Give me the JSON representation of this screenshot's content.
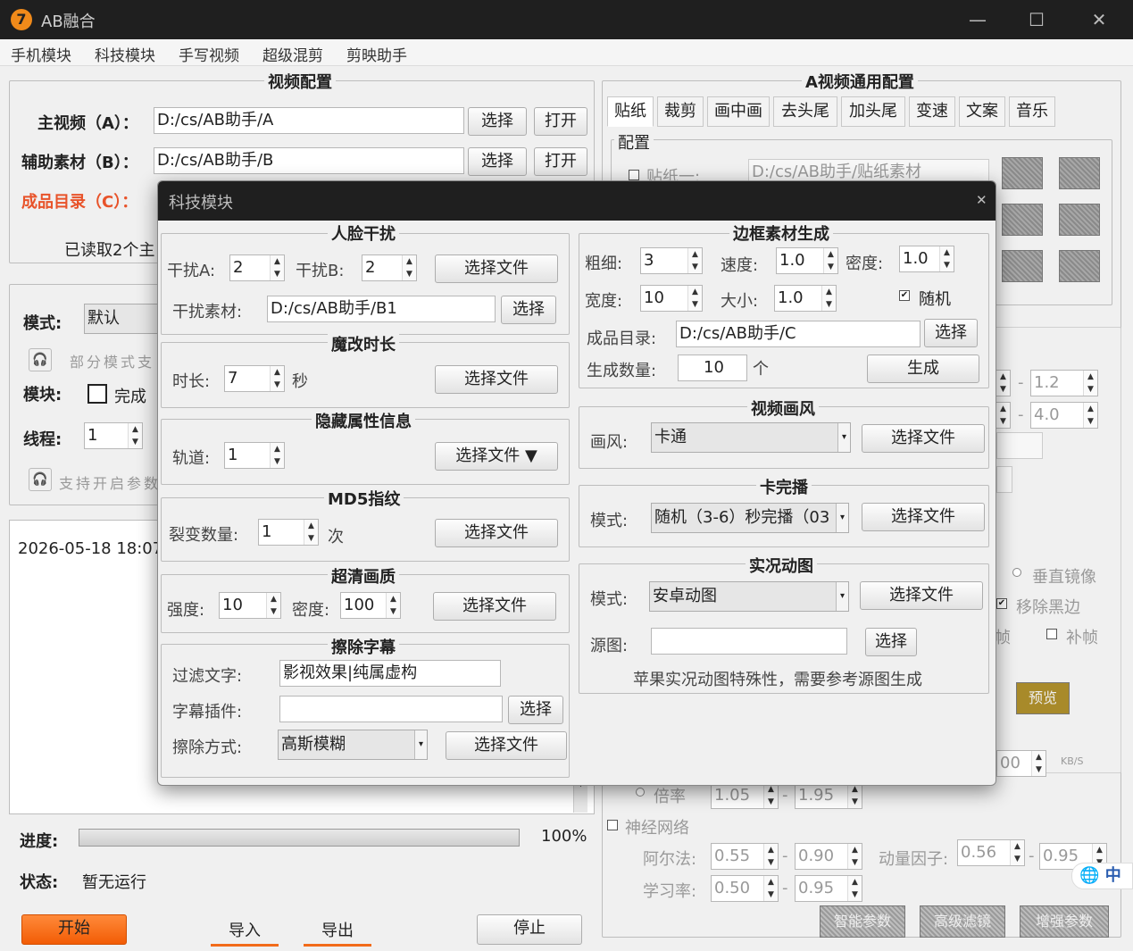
{
  "window": {
    "title": "AB融合",
    "icon_char": "7",
    "minimize": "—",
    "maximize": "☐",
    "close": "✕"
  },
  "menu": [
    "手机模块",
    "科技模块",
    "手写视频",
    "超级混剪",
    "剪映助手"
  ],
  "video_config": {
    "title": "视频配置",
    "main_label": "主视频（A）：",
    "main_path": "D:/cs/AB助手/A",
    "aux_label": "辅助素材（B）：",
    "aux_path": "D:/cs/AB助手/B",
    "output_label": "成品目录（C）：",
    "read_status": "已读取2个主",
    "select": "选择",
    "open": "打开"
  },
  "mode_section": {
    "mode_label": "模式:",
    "mode_value": "默认",
    "tip1": "部分模式支",
    "module_label": "模块:",
    "module_check_text": "完成",
    "thread_label": "线程:",
    "thread_value": "1",
    "tip2": "支持开启参数"
  },
  "log": {
    "line1": "2026-05-18 18:07"
  },
  "progress": {
    "label": "进度:",
    "value": 100,
    "text": "100%"
  },
  "status": {
    "label": "状态:",
    "value": "暂无运行"
  },
  "bottom_buttons": {
    "start": "开始",
    "import": "导入",
    "export": "导出",
    "stop": "停止"
  },
  "right_panel": {
    "title": "A视频通用配置",
    "tabs": [
      "贴纸",
      "裁剪",
      "画中画",
      "去头尾",
      "加头尾",
      "变速",
      "文案",
      "音乐"
    ],
    "config_title": "配置",
    "sticker_label": "贴纸一:",
    "sticker_path": "D:/cs/AB助手/贴纸素材",
    "range1_sep": "-",
    "range1_hi": "1.2",
    "range2_sep": "-",
    "range2_hi": "4.0",
    "vertical_mirror": "垂直镜像",
    "remove_black": "移除黑边",
    "frame_fill": "补帧",
    "frame_partial": "帧",
    "preview": "预览",
    "bitrate_partial": "00",
    "bitrate_unit": "KB/S",
    "ratio_label": "倍率",
    "ratio_lo": "1.05",
    "ratio_sep": "-",
    "ratio_hi": "1.95",
    "neural_label": "神经网络",
    "alpha_label": "阿尔法:",
    "alpha_lo": "0.55",
    "alpha_sep": "-",
    "alpha_hi": "0.90",
    "momentum_label": "动量因子:",
    "momentum_lo": "0.56",
    "momentum_sep": "-",
    "momentum_hi": "0.95",
    "lr_label": "学习率:",
    "lr_lo": "0.50",
    "lr_sep": "-",
    "lr_hi": "0.95",
    "ime_text": "中",
    "bottom_btns": [
      "智能参数",
      "高级滤镜",
      "增强参数"
    ]
  },
  "modal": {
    "title": "科技模块",
    "close": "✕",
    "face": {
      "title": "人脸干扰",
      "a_label": "干扰A:",
      "a_value": "2",
      "b_label": "干扰B:",
      "b_value": "2",
      "select_file": "选择文件",
      "material_label": "干扰素材:",
      "material_path": "D:/cs/AB助手/B1",
      "select": "选择"
    },
    "duration": {
      "title": "魔改时长",
      "label": "时长:",
      "value": "7",
      "unit": "秒",
      "select_file": "选择文件"
    },
    "hidden": {
      "title": "隐藏属性信息",
      "label": "轨道:",
      "value": "1",
      "select_file": "选择文件",
      "arrow": "▼"
    },
    "md5": {
      "title": "MD5指纹",
      "label": "裂变数量:",
      "value": "1",
      "unit": "次",
      "select_file": "选择文件"
    },
    "hd": {
      "title": "超清画质",
      "strength_label": "强度:",
      "strength_value": "10",
      "density_label": "密度:",
      "density_value": "100",
      "select_file": "选择文件"
    },
    "subtitle": {
      "title": "擦除字幕",
      "filter_label": "过滤文字:",
      "filter_value": "影视效果|纯属虚构",
      "plugin_label": "字幕插件:",
      "plugin_value": "",
      "select": "选择",
      "method_label": "擦除方式:",
      "method_value": "高斯模糊",
      "select_file": "选择文件"
    },
    "border": {
      "title": "边框素材生成",
      "thick_label": "粗细:",
      "thick_value": "3",
      "speed_label": "速度:",
      "speed_value": "1.0",
      "density_label": "密度:",
      "density_value": "1.0",
      "width_label": "宽度:",
      "width_value": "10",
      "size_label": "大小:",
      "size_value": "1.0",
      "random_label": "随机",
      "output_label": "成品目录:",
      "output_path": "D:/cs/AB助手/C",
      "select": "选择",
      "count_label": "生成数量:",
      "count_value": "10",
      "count_unit": "个",
      "generate": "生成"
    },
    "style": {
      "title": "视频画风",
      "label": "画风:",
      "value": "卡通",
      "select_file": "选择文件"
    },
    "card": {
      "title": "卡完播",
      "label": "模式:",
      "value": "随机（3-6）秒完播（03",
      "select_file": "选择文件"
    },
    "live": {
      "title": "实况动图",
      "mode_label": "模式:",
      "mode_value": "安卓动图",
      "select_file": "选择文件",
      "source_label": "源图:",
      "source_value": "",
      "select": "选择",
      "note": "苹果实况动图特殊性，需要参考源图生成"
    }
  }
}
